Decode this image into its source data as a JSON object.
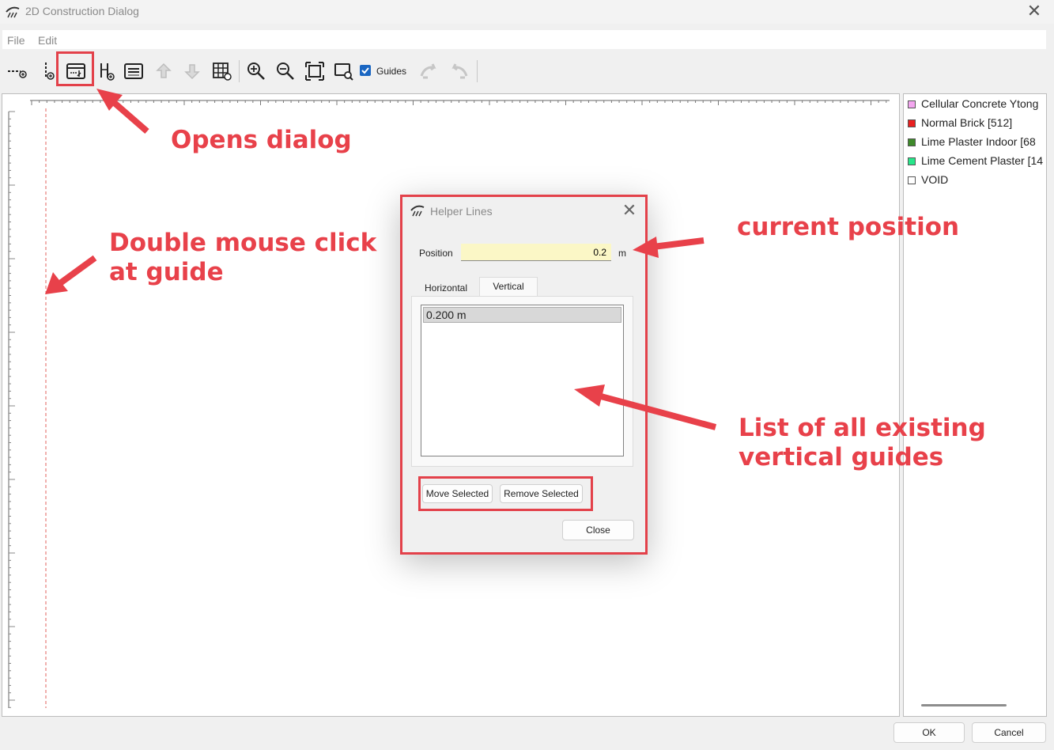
{
  "window": {
    "title": "2D Construction Dialog",
    "close_glyph": "✕"
  },
  "menu": {
    "items": [
      "File",
      "Edit"
    ]
  },
  "toolbar": {
    "icons": [
      "horizontal-guide-add-icon",
      "vertical-guide-add-icon",
      "helper-lines-dialog-icon",
      "dimension-add-icon",
      "layers-icon",
      "arrow-up-icon",
      "arrow-down-icon",
      "grid-icon",
      "zoom-in-icon",
      "zoom-out-icon",
      "zoom-fit-icon",
      "zoom-window-icon",
      "undo-icon",
      "redo-icon"
    ],
    "guides_label": "Guides",
    "guides_checked": true
  },
  "legend": {
    "items": [
      {
        "label": "Cellular Concrete Ytong",
        "color": "#f3a6ef"
      },
      {
        "label": "Normal Brick [512]",
        "color": "#e82020"
      },
      {
        "label": "Lime Plaster Indoor [68",
        "color": "#3e8a2a"
      },
      {
        "label": "Lime Cement Plaster [14",
        "color": "#27e68a"
      },
      {
        "label": "VOID",
        "color": "#ffffff"
      }
    ]
  },
  "dialog": {
    "title": "Helper Lines",
    "position_label": "Position",
    "position_value": "0.2",
    "position_unit": "m",
    "tabs": [
      "Horizontal",
      "Vertical"
    ],
    "active_tab": "Vertical",
    "guides": [
      "0.200 m"
    ],
    "move_label": "Move Selected",
    "remove_label": "Remove Selected",
    "close_label": "Close"
  },
  "footer": {
    "ok_label": "OK",
    "cancel_label": "Cancel"
  },
  "annotations": {
    "opens_dialog": "Opens dialog",
    "double_click": [
      "Double mouse click",
      "at guide"
    ],
    "current_position": "current position",
    "list_guides": [
      "List of all existing",
      "vertical guides"
    ],
    "color": "#e8414a"
  }
}
